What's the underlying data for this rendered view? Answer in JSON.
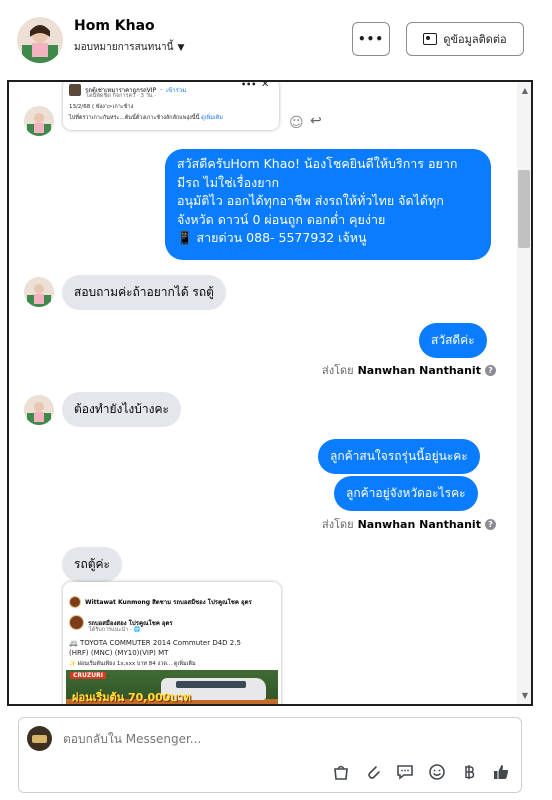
{
  "header": {
    "contact_name": "Hom Khao",
    "assign_label": "มอบหมายการสนทนานี้",
    "more_label": "•••",
    "contact_info_label": "ดูข้อมูลติดต่อ"
  },
  "post_card_1": {
    "page_name": "รถตู้เช่าเหมาราคาถูกรถVIP",
    "join_label": "เข้าร่วม",
    "meta": "โดนพัดชิด กิจการคว์ · 3 วัน ·",
    "line1": "13/2/68 ( พังงา>เกาะช้าง",
    "line2": "ไปที่ตรวาเกาะกันหร่ะ...ต้นนั้ตั่วงเกาะช้างลักลักแพงุ่งนี้นี้",
    "see_more": "ดูเพิ่มเติม"
  },
  "messages": {
    "welcome_lines": [
      "สวัสดีครับHom Khao! น้องโชคยินดีให้บริการ อยาก",
      "มีรถ ไม่ใช่เรื่องยาก",
      "อนุมัติไว ออกได้ทุกอาชีพ ส่งรถให้ทั่วไทย จัดได้ทุก",
      "จังหวัด ดาวน์ 0  ผ่อนถูก ดอกต่ำ คุยง่าย",
      "📱 สายด่วน 088- 5577932 เจ้หนู"
    ],
    "in_1": "สอบถามค่ะถ้าอยากได้ รถตู้",
    "out_1": "สวัสดีค่ะ",
    "in_2": "ต้องทำยังไงบ้างคะ",
    "out_2": "ลูกค้าสนใจรถรุ่นนี้อยู่นะคะ",
    "out_3": "ลูกค้าอยู่จังหวัดอะไรคะ",
    "in_3": "รถตู้ค่ะ"
  },
  "sent_by": {
    "prefix": "ส่งโดย",
    "agent": "Nanwhan Nanthanit",
    "help": "?"
  },
  "post_card_2": {
    "sharer": "Wittawat Kunmong สิตชาม รถบอสมืชอง โปรคูณโชค อุดร",
    "page_name": "รถบอสมืองสอง โปรคูณโชค อุดร",
    "meta": "ได้รับการแนะนำ · 🌐",
    "title1": "🚐 TOYOTA COMMUTER 2014 Commuter D4D 2.5",
    "title2": "(HRF) (MNC) (MY10)(VIP) MT",
    "detail": "✨ ผ่อนเริ่มต้นเพียง 1x,xxx บาท 84 งวด...",
    "see_more": "ดูเพิ่มเติม",
    "banner": "CRUZURI",
    "price_banner": "ผ่อนเริ่มต้น 70,000บาท"
  },
  "composer": {
    "placeholder": "ตอบกลับใน Messenger..."
  },
  "colors": {
    "accent": "#0a7cff",
    "incoming": "#e4e6eb"
  }
}
